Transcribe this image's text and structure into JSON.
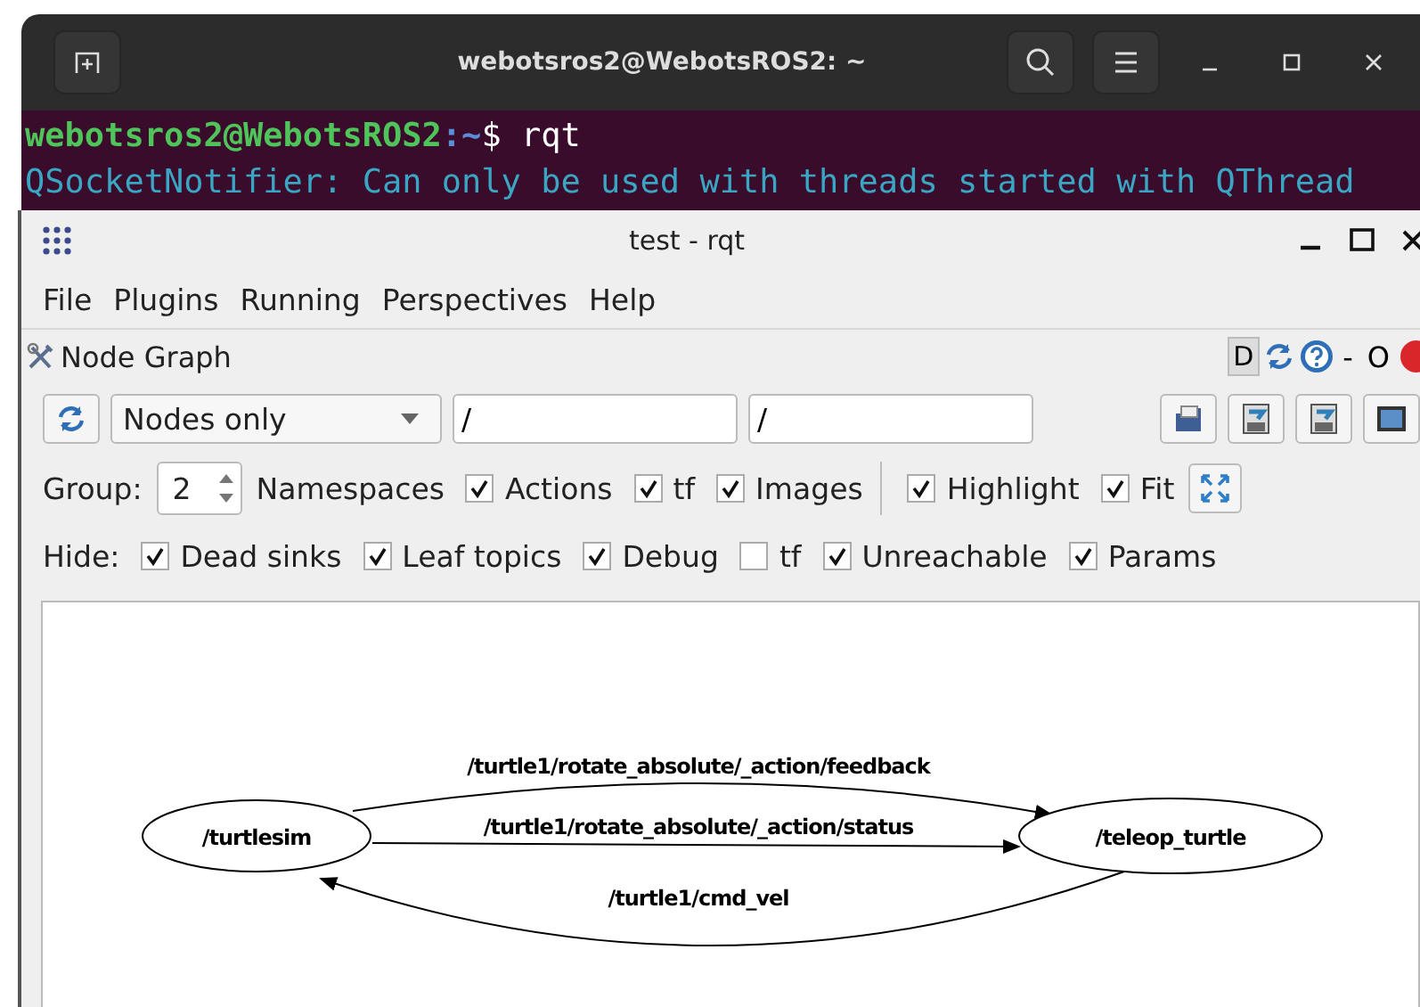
{
  "terminal": {
    "title": "webotsros2@WebotsROS2: ~",
    "prompt_user": "webotsros2@WebotsROS2",
    "prompt_path": ":~",
    "prompt_symbol": "$ ",
    "command": "rqt",
    "output": "QSocketNotifier: Can only be used with threads started with QThread"
  },
  "window": {
    "title": "test - rqt"
  },
  "menu": [
    "File",
    "Plugins",
    "Running",
    "Perspectives",
    "Help"
  ],
  "plugin": {
    "title": "Node Graph",
    "dock_button": "D",
    "minimize": "-",
    "float": "O"
  },
  "toolbar": {
    "mode": "Nodes only",
    "filter_1": "/",
    "filter_2": "/"
  },
  "group_row": {
    "label": "Group:",
    "value": "2",
    "unit": "Namespaces",
    "options": [
      {
        "label": "Actions",
        "checked": true
      },
      {
        "label": "tf",
        "checked": true
      },
      {
        "label": "Images",
        "checked": true
      }
    ],
    "view_options": [
      {
        "label": "Highlight",
        "checked": true
      },
      {
        "label": "Fit",
        "checked": true
      }
    ]
  },
  "hide_row": {
    "label": "Hide:",
    "options": [
      {
        "label": "Dead sinks",
        "checked": true
      },
      {
        "label": "Leaf topics",
        "checked": true
      },
      {
        "label": "Debug",
        "checked": true
      },
      {
        "label": "tf",
        "checked": false
      },
      {
        "label": "Unreachable",
        "checked": true
      },
      {
        "label": "Params",
        "checked": true
      }
    ]
  },
  "graph": {
    "nodes": [
      "/turtlesim",
      "/teleop_turtle"
    ],
    "edges": [
      {
        "label": "/turtle1/rotate_absolute/_action/feedback"
      },
      {
        "label": "/turtle1/rotate_absolute/_action/status"
      },
      {
        "label": "/turtle1/cmd_vel"
      }
    ]
  }
}
